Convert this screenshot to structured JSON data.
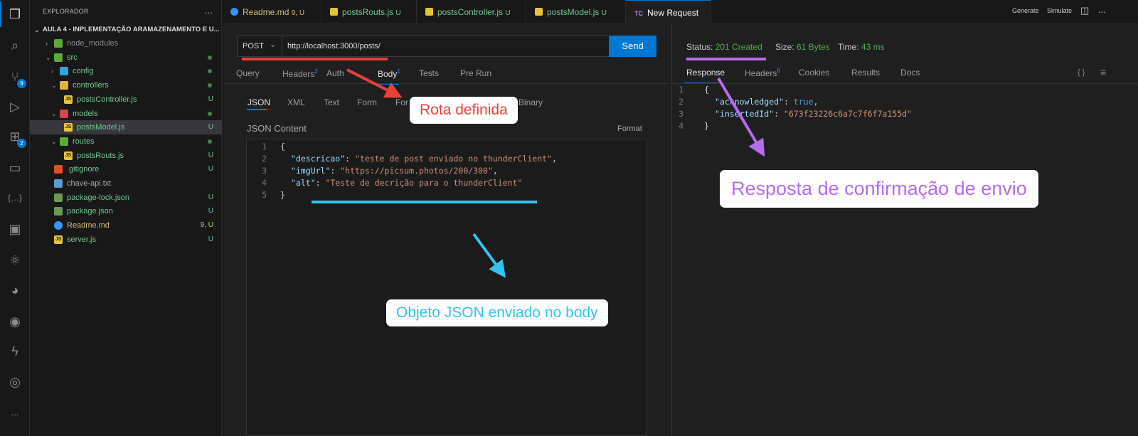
{
  "activity_bar": {
    "source_control_badge": "9",
    "extensions_badge": "2",
    "more": "..."
  },
  "sidebar": {
    "title": "EXPLORADOR",
    "more": "...",
    "project": "AULA 4 - INPLEMENTAÇÃO ARAMAZENAMENTO E U...",
    "items": [
      {
        "label": "node_modules",
        "status": ""
      },
      {
        "label": "src",
        "status": ""
      },
      {
        "label": "config",
        "status": ""
      },
      {
        "label": "controllers",
        "status": ""
      },
      {
        "label": "postsController.js",
        "status": "U"
      },
      {
        "label": "models",
        "status": ""
      },
      {
        "label": "postsModel.js",
        "status": "U"
      },
      {
        "label": "routes",
        "status": ""
      },
      {
        "label": "postsRouts.js",
        "status": "U"
      },
      {
        "label": ".gitignore",
        "status": "U"
      },
      {
        "label": "chave-api.txt",
        "status": ""
      },
      {
        "label": "package-lock.json",
        "status": "U"
      },
      {
        "label": "package.json",
        "status": "U"
      },
      {
        "label": "Readme.md",
        "status": "9, U"
      },
      {
        "label": "server.js",
        "status": "U"
      }
    ]
  },
  "tabs": [
    {
      "label": "Readme.md",
      "status": "9, U"
    },
    {
      "label": "postsRouts.js",
      "status": "U"
    },
    {
      "label": "postsController.js",
      "status": "U"
    },
    {
      "label": "postsModel.js",
      "status": "U"
    },
    {
      "label": "New Request",
      "icon_text": "TC",
      "close": "✕"
    }
  ],
  "tab_actions": {
    "generate": "Generate",
    "simulate": "Simulate",
    "more": "..."
  },
  "request": {
    "method": "POST",
    "url": "http://localhost:3000/posts/",
    "send": "Send",
    "tabs": [
      {
        "label": "Query"
      },
      {
        "label": "Headers",
        "count": "2"
      },
      {
        "label": "Auth"
      },
      {
        "label": "Body",
        "count": "1"
      },
      {
        "label": "Tests"
      },
      {
        "label": "Pre Run"
      }
    ],
    "body_tabs": [
      "JSON",
      "XML",
      "Text",
      "Form",
      "For",
      "Binary"
    ],
    "content_label": "JSON Content",
    "format": "Format",
    "body_lines": [
      "1",
      "2",
      "3",
      "4",
      "5"
    ],
    "body": {
      "l1": "{",
      "k2": "\"descricao\"",
      "v2": "\"teste de post enviado no thunderClient\"",
      "k3": "\"imgUrl\"",
      "v3": "\"https://picsum.photos/200/300\"",
      "k4": "\"alt\"",
      "v4": "\"Teste de decrição para o thunderClient\"",
      "l5": "}"
    }
  },
  "response": {
    "status_label": "Status:",
    "status": "201 Created",
    "size_label": "Size:",
    "size": "61 Bytes",
    "time_label": "Time:",
    "time": "43 ms",
    "tabs": [
      {
        "label": "Response"
      },
      {
        "label": "Headers",
        "count": "6"
      },
      {
        "label": "Cookies"
      },
      {
        "label": "Results"
      },
      {
        "label": "Docs"
      }
    ],
    "braces_icon": "{ }",
    "lines": [
      "1",
      "2",
      "3",
      "4"
    ],
    "body": {
      "l1": "{",
      "k2": "\"acknowledged\"",
      "v2": "true",
      "k3": "\"insertedId\"",
      "v3": "\"673f23226c6a7c7f6f7a155d\"",
      "l4": "}"
    }
  },
  "annotations": {
    "route": "Rota definida",
    "body": "Objeto JSON enviado no body",
    "response": "Resposta de confirmação de envio",
    "colors": {
      "route": "#e8413a",
      "body": "#34c3f0",
      "response": "#b56cf0"
    }
  }
}
